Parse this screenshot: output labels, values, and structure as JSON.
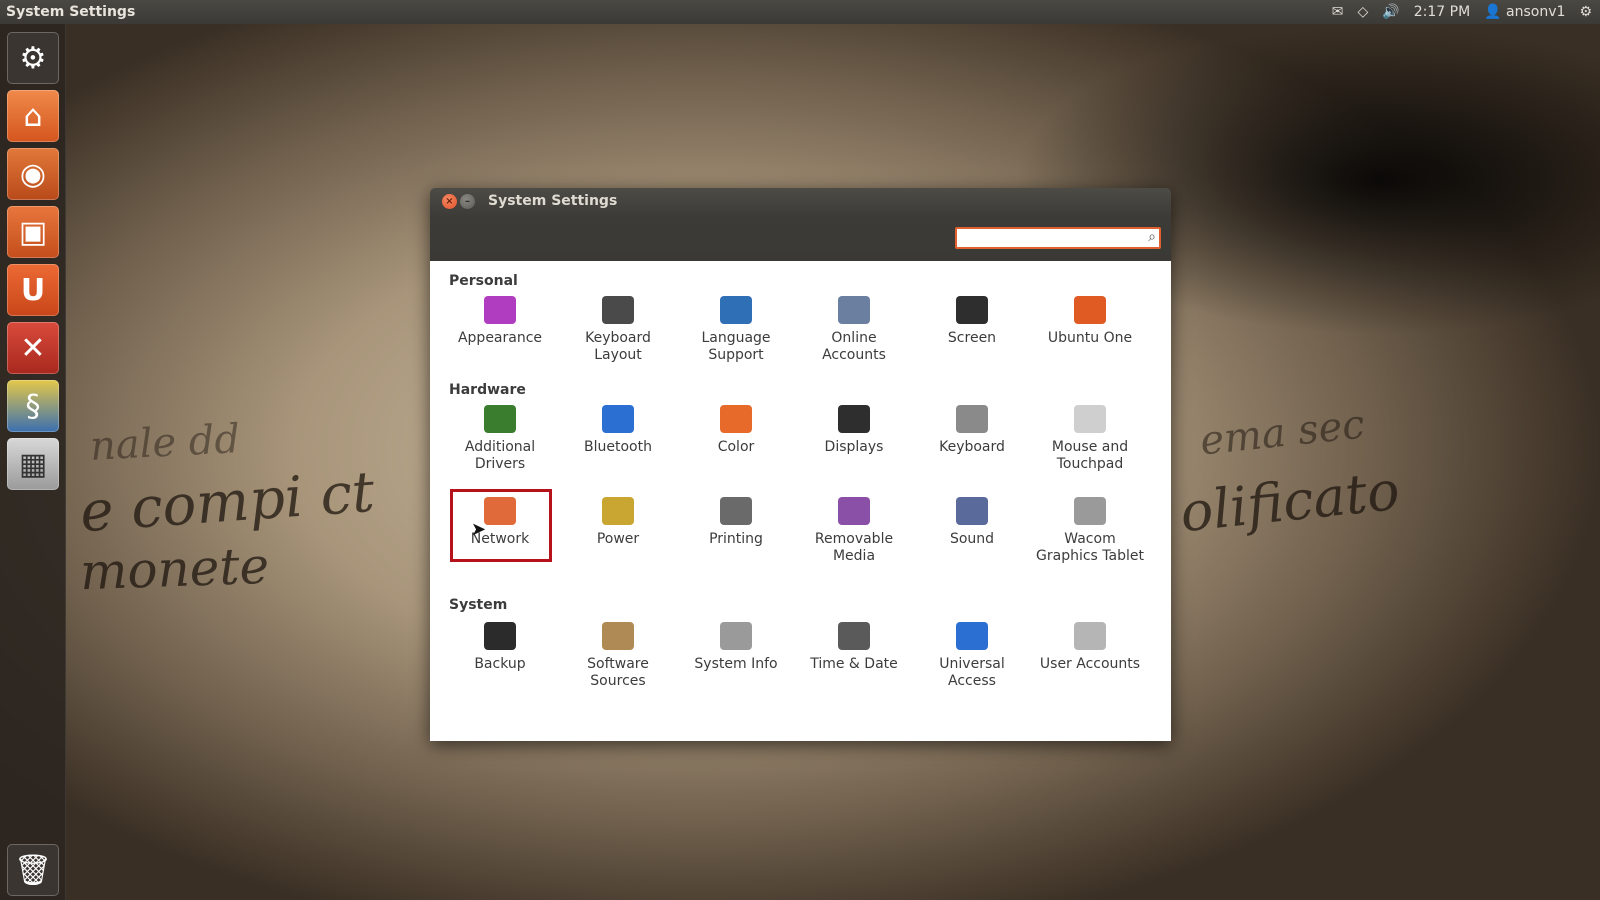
{
  "top_panel": {
    "title": "System Settings",
    "indicators": {
      "mail": "✉",
      "network": "◇",
      "sound": "🔊",
      "session": "⚙"
    },
    "clock": "2:17 PM",
    "user": "ansonv1"
  },
  "window": {
    "title": "System Settings",
    "search": {
      "value": "",
      "placeholder": ""
    },
    "sections": [
      {
        "title": "Personal",
        "items": [
          {
            "label": "Appearance",
            "icon": "appearance-icon",
            "color": "#b03dbf"
          },
          {
            "label": "Keyboard Layout",
            "icon": "keyboard-layout-icon",
            "color": "#4a4a4a"
          },
          {
            "label": "Language Support",
            "icon": "language-support-icon",
            "color": "#2f6fb5"
          },
          {
            "label": "Online Accounts",
            "icon": "online-accounts-icon",
            "color": "#6b7fa0"
          },
          {
            "label": "Screen",
            "icon": "screen-lock-icon",
            "color": "#2e2e2e"
          },
          {
            "label": "Ubuntu One",
            "icon": "ubuntu-one-icon",
            "color": "#e05a24"
          }
        ]
      },
      {
        "title": "Hardware",
        "items": [
          {
            "label": "Additional Drivers",
            "icon": "additional-drivers-icon",
            "color": "#3a7d2f"
          },
          {
            "label": "Bluetooth",
            "icon": "bluetooth-icon",
            "color": "#2a6fd1"
          },
          {
            "label": "Color",
            "icon": "color-icon",
            "color": "#e86a2b"
          },
          {
            "label": "Displays",
            "icon": "displays-icon",
            "color": "#2e2e2e"
          },
          {
            "label": "Keyboard",
            "icon": "keyboard-icon",
            "color": "#8a8a8a"
          },
          {
            "label": "Mouse and Touchpad",
            "icon": "mouse-icon",
            "color": "#cfcfcf"
          },
          {
            "label": "Network",
            "icon": "network-icon",
            "color": "#e06a3a"
          },
          {
            "label": "Power",
            "icon": "power-icon",
            "color": "#c9a531"
          },
          {
            "label": "Printing",
            "icon": "printer-icon",
            "color": "#6a6a6a"
          },
          {
            "label": "Removable Media",
            "icon": "removable-media-icon",
            "color": "#8a4fa6"
          },
          {
            "label": "Sound",
            "icon": "sound-icon",
            "color": "#5a6a9a"
          },
          {
            "label": "Wacom Graphics Tablet",
            "icon": "wacom-tablet-icon",
            "color": "#9a9a9a"
          }
        ]
      },
      {
        "title": "System",
        "items": [
          {
            "label": "Backup",
            "icon": "backup-safe-icon",
            "color": "#2b2b2b"
          },
          {
            "label": "Software Sources",
            "icon": "software-sources-icon",
            "color": "#b08a55"
          },
          {
            "label": "System Info",
            "icon": "system-info-gear-icon",
            "color": "#9a9a9a"
          },
          {
            "label": "Time & Date",
            "icon": "clock-icon",
            "color": "#5a5a5a"
          },
          {
            "label": "Universal Access",
            "icon": "universal-access-icon",
            "color": "#2a6fd1"
          },
          {
            "label": "User Accounts",
            "icon": "user-accounts-icon",
            "color": "#b5b5b5"
          }
        ]
      }
    ]
  }
}
